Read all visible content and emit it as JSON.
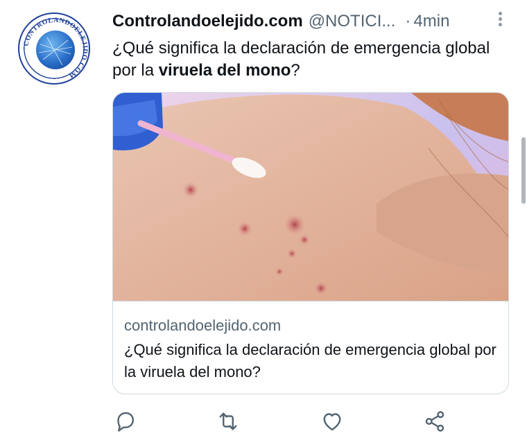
{
  "tweet": {
    "display_name": "Controlandoelejido.com",
    "handle": "@NOTICI...",
    "separator": "·",
    "time": "4min",
    "text_part1": "¿Qué significa la declaración de emergencia global por la ",
    "text_bold": "viruela del mono",
    "text_part2": "?"
  },
  "avatar": {
    "logo_text": "CONTROLANDOELEJIDO.COM"
  },
  "card": {
    "domain": "controlandoelejido.com",
    "title": "¿Qué significa la declaración de emergencia global por la viruela del mono?"
  },
  "actions": {
    "icons": [
      "reply-icon",
      "retweet-icon",
      "like-icon",
      "share-icon"
    ]
  },
  "colors": {
    "text": "#0f1419",
    "secondary": "#536471",
    "border": "#cfd9de",
    "icon": "#536471"
  }
}
